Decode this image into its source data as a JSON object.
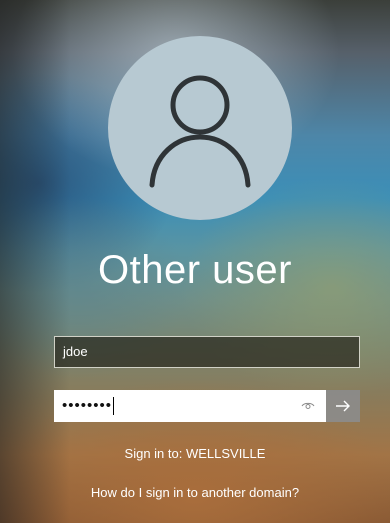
{
  "account": {
    "name": "Other user",
    "avatar_icon": "person-icon"
  },
  "form": {
    "username_value": "jdoe",
    "password_value": "••••••••",
    "reveal_icon": "eye-icon",
    "submit_icon": "arrow-right-icon"
  },
  "footer": {
    "sign_in_to": "Sign in to: WELLSVILLE",
    "other_domain_link": "How do I sign in to another domain?"
  },
  "colors": {
    "avatar_bg": "#b7c9d2",
    "submit_bg": "#8c8c8c",
    "text": "#ffffff"
  }
}
